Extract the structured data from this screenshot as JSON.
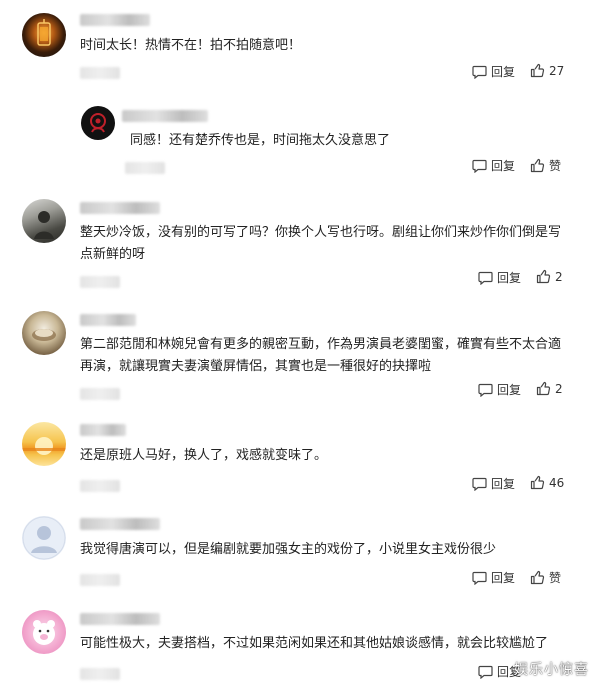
{
  "comments": [
    {
      "text": "时间太长！热情不在！拍不拍随意吧！",
      "reply": "回复",
      "like": "27"
    },
    {
      "text": "同感！还有楚乔传也是，时间拖太久没意思了",
      "reply": "回复",
      "like": "赞"
    },
    {
      "text": "整天炒冷饭，没有别的可写了吗？你换个人写也行呀。剧组让你们来炒作你们倒是写点新鲜的呀",
      "reply": "回复",
      "like": "2"
    },
    {
      "text": "第二部范閒和林婉兒會有更多的親密互動，作為男演員老婆閨蜜，確實有些不太合適再演，就讓現實夫妻演螢屏情侶，其實也是一種很好的抉擇啦",
      "reply": "回复",
      "like": "2"
    },
    {
      "text": "还是原班人马好，换人了，戏感就变味了。",
      "reply": "回复",
      "like": "46"
    },
    {
      "text": "我觉得唐演可以，但是编剧就要加强女主的戏份了，小说里女主戏份很少",
      "reply": "回复",
      "like": "赞"
    },
    {
      "text": "可能性极大，夫妻搭档，不过如果范闲如果还和其他姑娘谈感情，就会比较尴尬了",
      "reply": "回复",
      "like": ""
    }
  ],
  "watermark": "娱乐小惊喜",
  "icons": {
    "reply": "comment-bubble-icon",
    "like": "thumbs-up-icon"
  }
}
